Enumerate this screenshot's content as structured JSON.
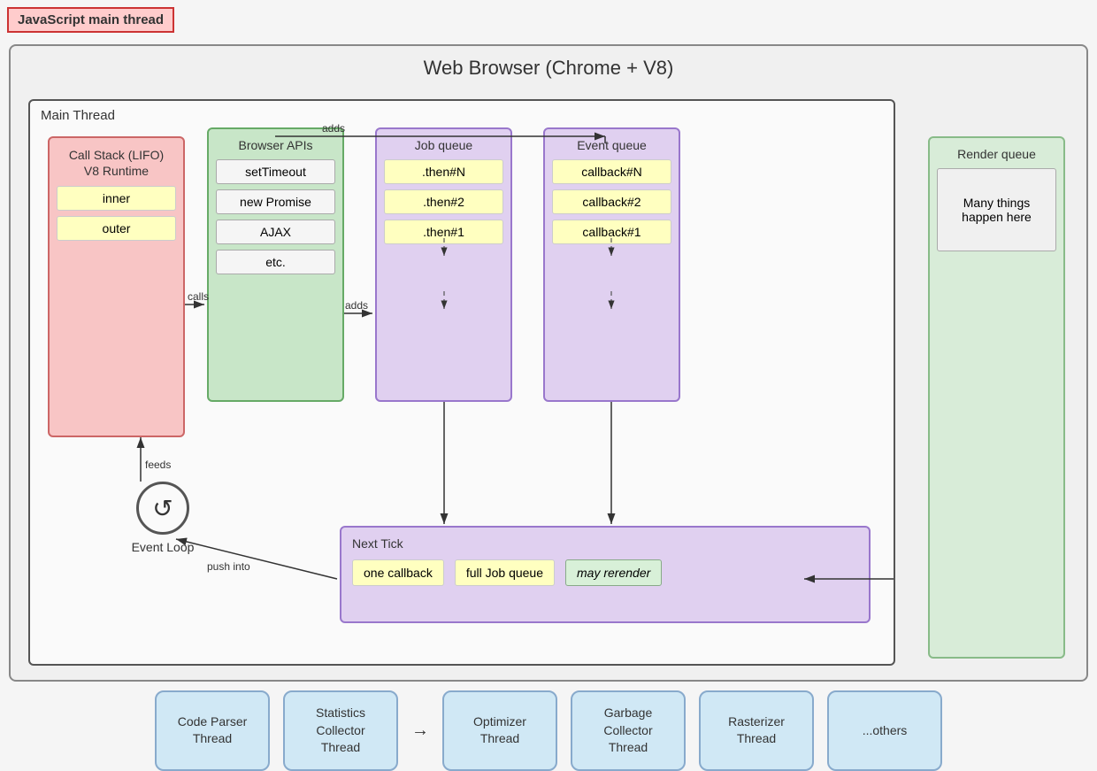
{
  "jsMainThread": {
    "label": "JavaScript main thread"
  },
  "webBrowser": {
    "title": "Web Browser (Chrome + V8)"
  },
  "mainThread": {
    "label": "Main Thread"
  },
  "callStack": {
    "title": "Call Stack (LIFO)\nV8 Runtime",
    "items": [
      "inner",
      "outer"
    ]
  },
  "browserApis": {
    "title": "Browser APIs",
    "items": [
      "setTimeout",
      "new Promise",
      "AJAX",
      "etc."
    ]
  },
  "jobQueue": {
    "title": "Job queue",
    "items": [
      ".then#N",
      ".then#2",
      ".then#1"
    ]
  },
  "eventQueue": {
    "title": "Event queue",
    "items": [
      "callback#N",
      "callback#2",
      "callback#1"
    ]
  },
  "renderQueue": {
    "title": "Render queue",
    "content": "Many things happen here"
  },
  "nextTick": {
    "title": "Next Tick",
    "items": [
      "one callback",
      "full Job queue",
      "may rerender"
    ]
  },
  "eventLoop": {
    "label": "Event Loop"
  },
  "arrows": {
    "calls": "calls",
    "adds1": "adds",
    "adds2": "adds",
    "feeds": "feeds",
    "pushInto": "push into"
  },
  "bottomThreads": [
    {
      "label": "Code Parser\nThread"
    },
    {
      "label": "Statistics\nCollector\nThread"
    },
    {
      "label": "Optimizer\nThread"
    },
    {
      "label": "Garbage\nCollector\nThread"
    },
    {
      "label": "Rasterizer\nThread"
    },
    {
      "label": "...others"
    }
  ]
}
